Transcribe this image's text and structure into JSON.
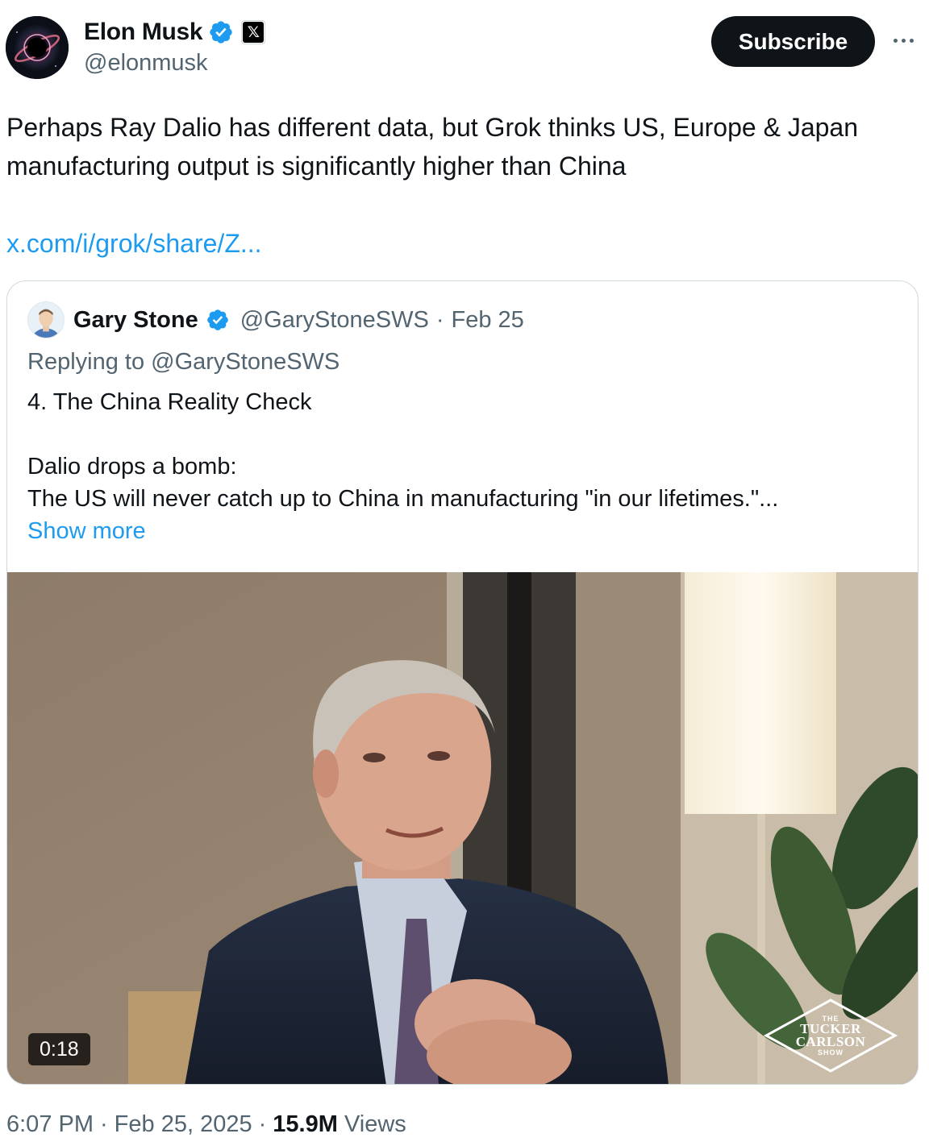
{
  "author": {
    "name": "Elon Musk",
    "handle": "@elonmusk",
    "verified": true,
    "affiliate_badge": "𝕏"
  },
  "actions": {
    "subscribe_label": "Subscribe"
  },
  "tweet": {
    "text": "Perhaps Ray Dalio has different data, but Grok thinks US, Europe & Japan manufacturing output is significantly higher than China",
    "link": "x.com/i/grok/share/Z..."
  },
  "quote": {
    "name": "Gary Stone",
    "handle": "@GaryStoneSWS",
    "separator": "·",
    "date": "Feb 25",
    "replying_to": "Replying to @GaryStoneSWS",
    "body_line1": "4. The China Reality Check",
    "body_line2": "Dalio drops a bomb:\nThe US will never catch up to China in manufacturing \"in our lifetimes.\"...",
    "show_more": "Show more",
    "video": {
      "duration": "0:18",
      "logo_top": "THE",
      "logo_line1": "TUCKER",
      "logo_line2": "CARLSON",
      "logo_bottom": "SHOW"
    }
  },
  "footer": {
    "time": "6:07 PM",
    "dot1": "·",
    "date": "Feb 25, 2025",
    "dot2": "·",
    "views_count": "15.9M",
    "views_label": "Views"
  },
  "colors": {
    "link": "#1d9bf0",
    "text": "#0f1419",
    "secondary": "#536471",
    "border": "#cfd9de",
    "verified": "#1d9bf0"
  }
}
